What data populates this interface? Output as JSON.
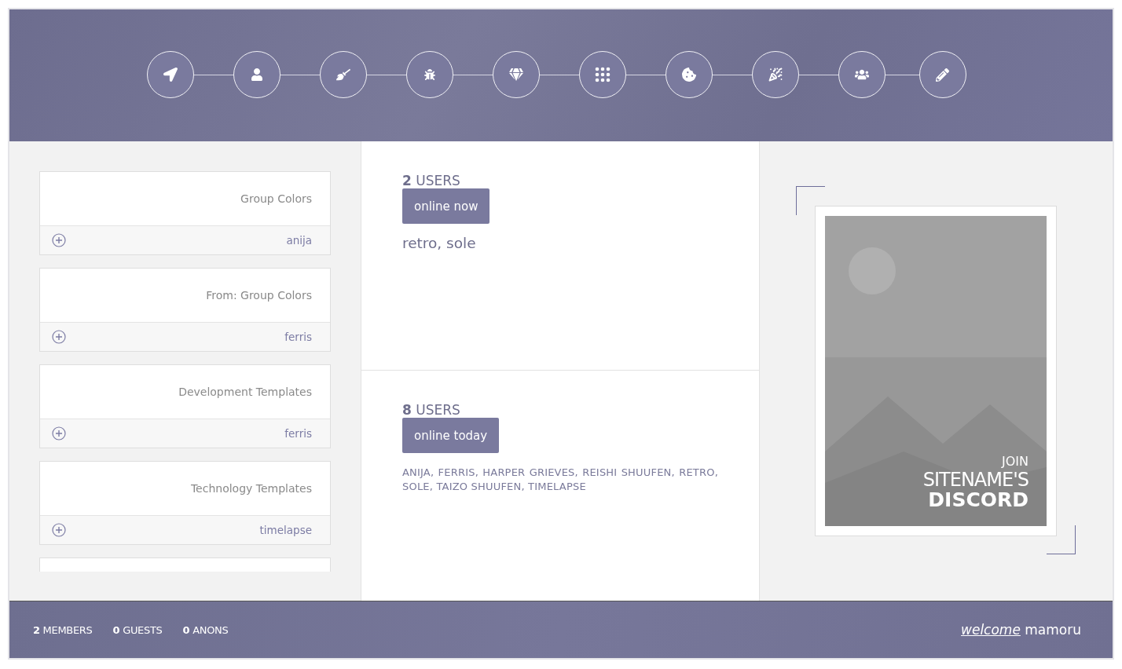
{
  "topics": [
    {
      "title": "Group Colors",
      "author": "anija"
    },
    {
      "title": "From: Group Colors",
      "author": "ferris"
    },
    {
      "title": "Development Templates",
      "author": "ferris"
    },
    {
      "title": "Technology Templates",
      "author": "timelapse"
    }
  ],
  "online_now": {
    "heading": "**2** USERS",
    "button": "online now",
    "names": "retro, sole"
  },
  "online_today": {
    "heading": "**8** USERS",
    "button": "online today",
    "names": "ANIJA, FERRIS, HARPER GRIEVES, REISHI SHUUFEN, RETRO, SOLE, TAIZO SHUUFEN, TIMELAPSE"
  },
  "discord": {
    "lines": [
      {
        "kind": "small",
        "text": "JOIN"
      },
      {
        "kind": "light",
        "text": "SITENAME'S"
      },
      {
        "kind": "bold",
        "text": "DISCORD"
      }
    ]
  },
  "footer": {
    "stats": [
      "**2** MEMBERS",
      "**0** GUESTS",
      "**0** ANONS"
    ],
    "welcome": "*welcome* mamoru"
  }
}
